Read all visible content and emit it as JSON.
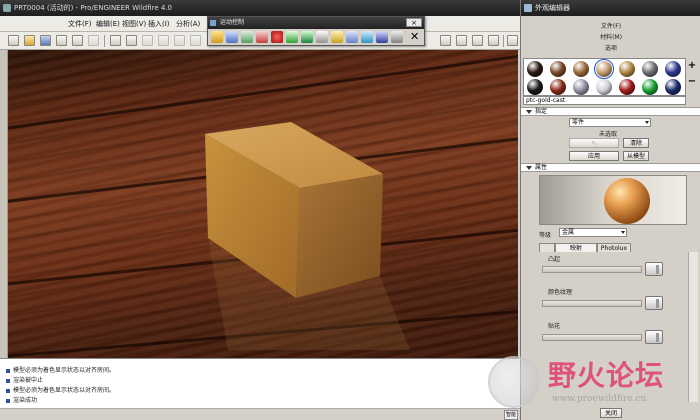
{
  "main_window": {
    "title": "PRT0004 (活动的) - Pro/ENGINEER Wildfire 4.0",
    "menu": [
      "文件(F)",
      "编辑(E)",
      "视图(V)",
      "插入(I)",
      "分析(A)"
    ]
  },
  "animation_palette": {
    "title": "运动控制",
    "close_glyph": "×",
    "x_glyph": "✕"
  },
  "messages": [
    "模型必须为着色显示状态以对齐房间。",
    "渲染被中止",
    "模型必须为着色显示状态以对齐房间。",
    "渲染成功"
  ],
  "status_field": "智能",
  "appearance_editor": {
    "title": "外观编辑器",
    "menu": [
      "文件(F)",
      "材料(M)",
      "选项"
    ],
    "swatch_colors": [
      "#2a1a10",
      "#7a4a2a",
      "#9a6a3a",
      "#c8a070",
      "#b08840",
      "#707070",
      "#303a90",
      "#1a1a1a",
      "#8a2a1a",
      "#9090a0",
      "#d0d0d8",
      "#a01818",
      "#18a030",
      "#1a2a6a"
    ],
    "selected_swatch": 3,
    "plus": "+",
    "minus": "−",
    "material_name": "ptc-gold-cast",
    "assign_section": "指定",
    "assign_dropdown": "零件",
    "selection_status": "未选取",
    "clear_button": "清除",
    "apply_button": "应用",
    "from_model_button": "从模型",
    "properties_section": "属性",
    "class_label": "等级",
    "class_dropdown": "金属",
    "tabs": [
      "",
      "映射",
      "Photolux"
    ],
    "props": [
      "凸起",
      "颜色纹理",
      "贴花"
    ],
    "close_button": "关闭"
  },
  "watermark": {
    "text": "野火论坛",
    "url": "www.proewildfire.cn"
  },
  "colors": {
    "titlebar": "#222222",
    "panel_bg": "#d4d0c8",
    "wood": "#6a2e16",
    "cube": "#c8964a"
  }
}
